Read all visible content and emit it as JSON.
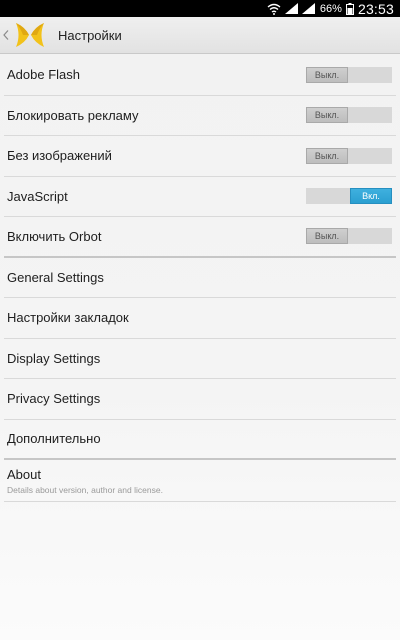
{
  "status_bar": {
    "battery_percent": "66%",
    "time": "23:53"
  },
  "action_bar": {
    "title": "Настройки"
  },
  "toggles": [
    {
      "label": "Adobe Flash",
      "state": "Выкл.",
      "on": false
    },
    {
      "label": "Блокировать рекламу",
      "state": "Выкл.",
      "on": false
    },
    {
      "label": "Без изображений",
      "state": "Выкл.",
      "on": false
    },
    {
      "label": "JavaScript",
      "state": "Вкл.",
      "on": true
    },
    {
      "label": "Включить Orbot",
      "state": "Выкл.",
      "on": false
    }
  ],
  "menu": [
    {
      "label": "General Settings"
    },
    {
      "label": "Настройки закладок"
    },
    {
      "label": "Display Settings"
    },
    {
      "label": "Privacy Settings"
    },
    {
      "label": "Дополнительно"
    }
  ],
  "about": {
    "label": "About",
    "summary": "Details about version, author and license."
  },
  "colors": {
    "switch_on": "#2b9fd1",
    "switch_off": "#c4c4c4",
    "logo": "#f2c21a"
  }
}
